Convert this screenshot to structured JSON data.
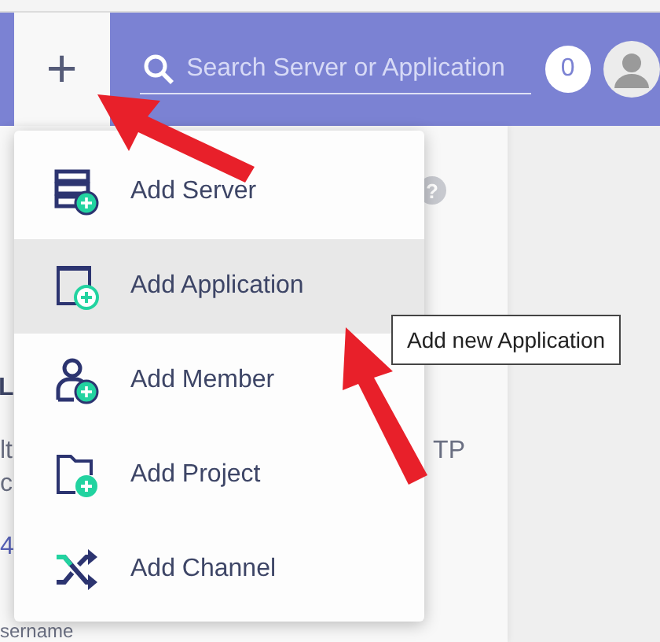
{
  "toolbar": {
    "add_button": "+",
    "search": {
      "placeholder": "Search Server or Application"
    },
    "notification_count": "0"
  },
  "page_behind": {
    "help_icon": "?",
    "heading_fragment": "L",
    "line_1_start": "lt",
    "line_1_end": "TP",
    "line_2_start": "c",
    "value_fragment": "4",
    "field_label_fragment": "sername"
  },
  "menu": {
    "items": [
      {
        "label": "Add Server",
        "kind": "server",
        "selected": false
      },
      {
        "label": "Add Application",
        "kind": "application",
        "selected": true
      },
      {
        "label": "Add Member",
        "kind": "member",
        "selected": false
      },
      {
        "label": "Add Project",
        "kind": "project",
        "selected": false
      },
      {
        "label": "Add Channel",
        "kind": "channel",
        "selected": false
      }
    ]
  },
  "tooltip": "Add new Application"
}
